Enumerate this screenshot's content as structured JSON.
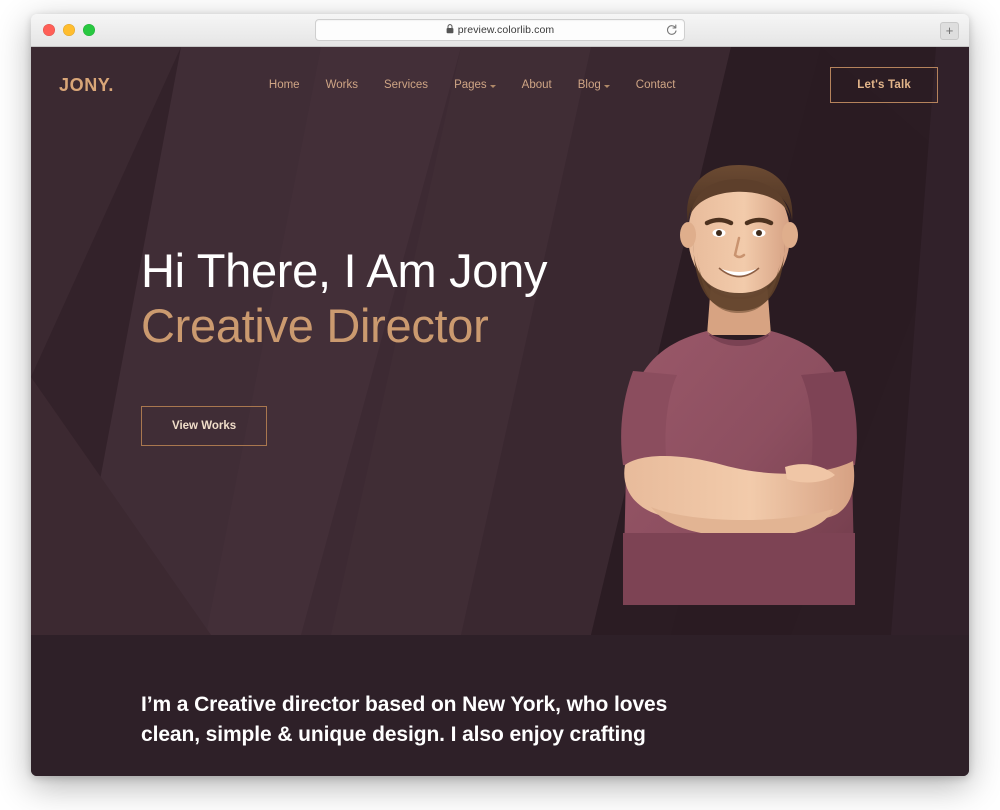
{
  "browser": {
    "url": "preview.colorlib.com",
    "lock_icon": "lock-icon",
    "reload_icon": "reload-icon",
    "newtab_label": "+",
    "traffic_lights": [
      "close-red",
      "minimize-yellow",
      "maximize-green"
    ]
  },
  "site": {
    "logo": "JONY.",
    "nav": [
      {
        "label": "Home",
        "has_dropdown": false
      },
      {
        "label": "Works",
        "has_dropdown": false
      },
      {
        "label": "Services",
        "has_dropdown": false
      },
      {
        "label": "Pages",
        "has_dropdown": true
      },
      {
        "label": "About",
        "has_dropdown": false
      },
      {
        "label": "Blog",
        "has_dropdown": true
      },
      {
        "label": "Contact",
        "has_dropdown": false
      }
    ],
    "cta_label": "Let's Talk",
    "hero": {
      "headline": "Hi There, I Am Jony",
      "subheadline": "Creative Director",
      "button_label": "View Works",
      "portrait_alt": "Smiling bearded man with arms crossed wearing a maroon t-shirt"
    },
    "intro": {
      "text": "I’m a Creative director based on New York, who loves clean, simple & unique design. I also enjoy crafting"
    }
  },
  "colors": {
    "hero_base": "#33222a",
    "hero_light": "#443039",
    "hero_dark": "#2b1c23",
    "intro_bg": "#2e2028",
    "accent_tan": "#cb9a6f",
    "logo_tan": "#d9a678",
    "nav_tan": "#cfa585",
    "white": "#ffffff",
    "shirt_maroon": "#8d4f60"
  }
}
